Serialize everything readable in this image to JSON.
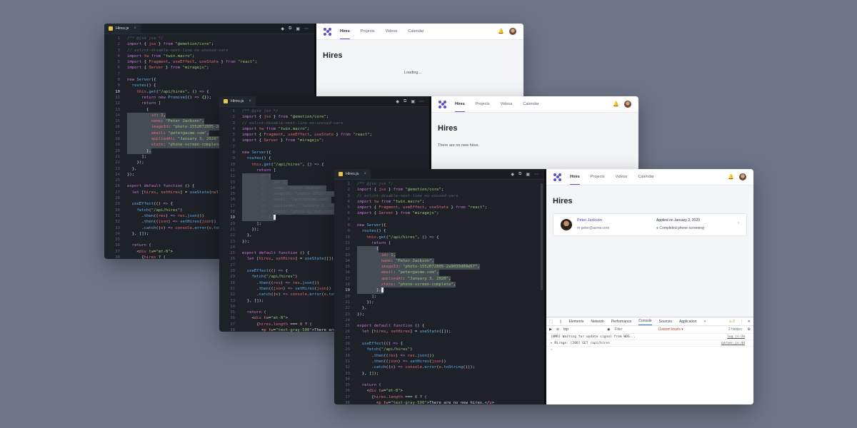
{
  "editor": {
    "filename": "Hires.js",
    "tab_close": "×",
    "icons": [
      "diamond-icon",
      "split-icon",
      "layout-icon",
      "more-icon"
    ],
    "icon_glyphs": [
      "◆",
      "⧉",
      "▣",
      "⋯"
    ]
  },
  "code_a": [
    [
      "1",
      "<span class='c'>/** @jsx jsx */</span>"
    ],
    [
      "2",
      "<span class='k'>import</span> { <span class='t'>jsx</span> } <span class='k'>from</span> <span class='s'>\"@emotion/core\"</span>;"
    ],
    [
      "3",
      "<span class='c'>// eslint-disable-next-line no-unused-vars</span>"
    ],
    [
      "4",
      "<span class='k'>import</span> <span class='t'>tw</span> <span class='k'>from</span> <span class='s'>\"twin.macro\"</span>;"
    ],
    [
      "5",
      "<span class='k'>import</span> { <span class='t'>Fragment</span>, <span class='t'>useEffect</span>, <span class='t'>useState</span> } <span class='k'>from</span> <span class='s'>\"react\"</span>;"
    ],
    [
      "6",
      "<span class='k'>import</span> { <span class='t'>Server</span> } <span class='k'>from</span> <span class='s'>\"miragejs\"</span>;"
    ],
    [
      "7",
      ""
    ],
    [
      "8",
      "<span class='k'>new</span> <span class='f'>Server</span>({"
    ],
    [
      "9",
      "  <span class='f'>routes</span>() {"
    ],
    [
      "10",
      "    <span class='t'>this</span>.<span class='f'>get</span>(<span class='s'>\"/api/hires\"</span>, () <span class='k'>=></span> {"
    ],
    [
      "11",
      "      <span class='k'>return new</span> <span class='f'>Promise</span>(() <span class='k'>=></span> {});"
    ],
    [
      "12",
      "      <span class='k'>return</span> ["
    ],
    [
      "13",
      "        {"
    ],
    [
      "14",
      "          <span class='t'>id</span>: <span class='n'>1</span>,"
    ],
    [
      "15",
      "          <span class='t'>name</span>: <span class='s'>\"Peter Jackson\"</span>,"
    ],
    [
      "16",
      "          <span class='t'>imageId</span>: <span class='s'>\"photo-1552072805-2a9039d00e57\"</span>,"
    ],
    [
      "17",
      "          <span class='t'>email</span>: <span class='s'>\"peter@acme.com\"</span>,"
    ],
    [
      "18",
      "          <span class='t'>appliedAt</span>: <span class='s'>\"January 3, 2020\"</span>,"
    ],
    [
      "19",
      "          <span class='t'>state</span>: <span class='s'>\"phone-screen-complete\"</span>,"
    ],
    [
      "20",
      "        },"
    ],
    [
      "21",
      "      ];"
    ],
    [
      "22",
      "    });"
    ],
    [
      "23",
      "  },"
    ],
    [
      "24",
      "});"
    ],
    [
      "25",
      ""
    ],
    [
      "26",
      "<span class='k'>export default function</span> () {"
    ],
    [
      "27",
      "  <span class='k'>let</span> [<span class='t'>hires</span>, <span class='t'>setHires</span>] = <span class='f'>useState</span>(<span class='n'>null</span>);"
    ],
    [
      "28",
      ""
    ],
    [
      "29",
      "  <span class='f'>useEffect</span>(() <span class='k'>=></span> {"
    ],
    [
      "30",
      "    <span class='f'>fetch</span>(<span class='s'>\"/api/hires\"</span>)"
    ],
    [
      "31",
      "      .<span class='f'>then</span>((<span class='t'>res</span>) <span class='k'>=></span> <span class='t'>res</span>.<span class='f'>json</span>())"
    ],
    [
      "32",
      "      .<span class='f'>then</span>((<span class='t'>json</span>) <span class='k'>=></span> <span class='f'>setHires</span>(<span class='t'>json</span>))"
    ],
    [
      "33",
      "      .<span class='f'>catch</span>((<span class='t'>e</span>) <span class='k'>=></span> <span class='t'>console</span>.<span class='f'>error</span>(<span class='t'>e</span>.<span class='f'>toString</span>()));"
    ],
    [
      "34",
      "  }, []);"
    ],
    [
      "35",
      ""
    ],
    [
      "36",
      "  <span class='k'>return</span> ("
    ],
    [
      "37",
      "    &lt;<span class='t'>div</span> <span class='n'>tw</span>=<span class='s'>\"mt-8\"</span>&gt;"
    ],
    [
      "38",
      "      {<span class='t'>hires</span> ? ("
    ]
  ],
  "code_b": [
    [
      "1",
      "<span class='c'>/** @jsx jsx */</span>"
    ],
    [
      "2",
      "<span class='k'>import</span> { <span class='t'>jsx</span> } <span class='k'>from</span> <span class='s'>\"@emotion/core\"</span>;"
    ],
    [
      "3",
      "<span class='c'>// eslint-disable-next-line no-unused-vars</span>"
    ],
    [
      "4",
      "<span class='k'>import</span> <span class='t'>tw</span> <span class='k'>from</span> <span class='s'>\"twin.macro\"</span>;"
    ],
    [
      "5",
      "<span class='k'>import</span> { <span class='t'>Fragment</span>, <span class='t'>useEffect</span>, <span class='t'>useState</span> } <span class='k'>from</span> <span class='s'>\"react\"</span>;"
    ],
    [
      "6",
      "<span class='k'>import</span> { <span class='t'>Server</span> } <span class='k'>from</span> <span class='s'>\"miragejs\"</span>;"
    ],
    [
      "7",
      ""
    ],
    [
      "8",
      "<span class='k'>new</span> <span class='f'>Server</span>({"
    ],
    [
      "9",
      "  <span class='f'>routes</span>() {"
    ],
    [
      "10",
      "    <span class='t'>this</span>.<span class='f'>get</span>(<span class='s'>\"/api/hires\"</span>, () <span class='k'>=></span> {"
    ],
    [
      "11",
      "      <span class='k'>return</span> ["
    ],
    [
      "12",
      "<span class='c'>        // {</span>"
    ],
    [
      "13",
      "<span class='c'>        //   id: 1,</span>"
    ],
    [
      "14",
      "<span class='c'>        //   name: \"Peter Jackson\",</span>"
    ],
    [
      "15",
      "<span class='c'>        //   imageId: \"photo-1552072805-2</span>"
    ],
    [
      "16",
      "<span class='c'>        //   email: \"peter@acme.com\",</span>"
    ],
    [
      "17",
      "<span class='c'>        //   appliedAt: \"January 3, 2020\"</span>"
    ],
    [
      "18",
      "<span class='c'>        //   state: \"phone-screen-complete</span>"
    ],
    [
      "19",
      "<span class='c'>        // },</span><span class='cursor'></span>"
    ],
    [
      "20",
      "      ];"
    ],
    [
      "21",
      "    });"
    ],
    [
      "22",
      "  },"
    ],
    [
      "23",
      "});"
    ],
    [
      "24",
      ""
    ],
    [
      "25",
      "<span class='k'>export default function</span> () {"
    ],
    [
      "26",
      "  <span class='k'>let</span> [<span class='t'>hires</span>, <span class='t'>setHires</span>] = <span class='f'>useState</span>([]);"
    ],
    [
      "27",
      ""
    ],
    [
      "28",
      "  <span class='f'>useEffect</span>(() <span class='k'>=></span> {"
    ],
    [
      "29",
      "    <span class='f'>fetch</span>(<span class='s'>\"/api/hires\"</span>)"
    ],
    [
      "30",
      "      .<span class='f'>then</span>((<span class='t'>res</span>) <span class='k'>=></span> <span class='t'>res</span>.<span class='f'>json</span>())"
    ],
    [
      "31",
      "      .<span class='f'>then</span>((<span class='t'>json</span>) <span class='k'>=></span> <span class='f'>setHires</span>(<span class='t'>json</span>))"
    ],
    [
      "32",
      "      .<span class='f'>catch</span>((<span class='t'>e</span>) <span class='k'>=></span> <span class='t'>console</span>.<span class='f'>error</span>(<span class='t'>e</span>.<span class='f'>toStrin</span>"
    ],
    [
      "33",
      "  }, []);"
    ],
    [
      "34",
      ""
    ],
    [
      "35",
      "  <span class='k'>return</span> ("
    ],
    [
      "36",
      "    &lt;<span class='t'>div</span> <span class='n'>tw</span>=<span class='s'>\"mt-8\"</span>&gt;"
    ],
    [
      "37",
      "      {<span class='t'>hires</span>.<span class='t'>length</span> === <span class='n'>0</span> ? ("
    ],
    [
      "38",
      "        &lt;<span class='t'>p</span> <span class='n'>tw</span>=<span class='s'>\"text-gray-500\"</span>&gt;There are no"
    ]
  ],
  "code_c": [
    [
      "1",
      "<span class='c'>/** @jsx jsx */</span>"
    ],
    [
      "2",
      "<span class='k'>import</span> { <span class='t'>jsx</span> } <span class='k'>from</span> <span class='s'>\"@emotion/core\"</span>;"
    ],
    [
      "3",
      "<span class='c'>// eslint-disable-next-line no-unused-vars</span>"
    ],
    [
      "4",
      "<span class='k'>import</span> <span class='t'>tw</span> <span class='k'>from</span> <span class='s'>\"twin.macro\"</span>;"
    ],
    [
      "5",
      "<span class='k'>import</span> { <span class='t'>Fragment</span>, <span class='t'>useEffect</span>, <span class='t'>useState</span> } <span class='k'>from</span> <span class='s'>\"react\"</span>;"
    ],
    [
      "6",
      "<span class='k'>import</span> { <span class='t'>Server</span> } <span class='k'>from</span> <span class='s'>\"miragejs\"</span>;"
    ],
    [
      "7",
      ""
    ],
    [
      "8",
      "<span class='k'>new</span> <span class='f'>Server</span>({"
    ],
    [
      "9",
      "  <span class='f'>routes</span>() {"
    ],
    [
      "10",
      "    <span class='t'>this</span>.<span class='f'>get</span>(<span class='s'>\"/api/hires\"</span>, () <span class='k'>=></span> {"
    ],
    [
      "11",
      "      <span class='k'>return</span> ["
    ],
    [
      "12",
      "        {"
    ],
    [
      "13",
      "          <span class='t'>id</span>: <span class='n'>1</span>,"
    ],
    [
      "14",
      "          <span class='t'>name</span>: <span class='s'>\"Peter Jackson\"</span>,"
    ],
    [
      "15",
      "          <span class='t'>imageId</span>: <span class='s'>\"photo-1552072805-2a9039d00e57\"</span>,"
    ],
    [
      "16",
      "          <span class='t'>email</span>: <span class='s'>\"peter@acme.com\"</span>,"
    ],
    [
      "17",
      "          <span class='t'>appliedAt</span>: <span class='s'>\"January 3, 2020\"</span>,"
    ],
    [
      "18",
      "          <span class='t'>state</span>: <span class='s'>\"phone-screen-complete\"</span>,"
    ],
    [
      "19",
      "        },<span class='cursor'></span>"
    ],
    [
      "20",
      "      ];"
    ],
    [
      "21",
      "    });"
    ],
    [
      "22",
      "  },"
    ],
    [
      "23",
      "});"
    ],
    [
      "24",
      ""
    ],
    [
      "25",
      "<span class='k'>export default function</span> () {"
    ],
    [
      "26",
      "  <span class='k'>let</span> [<span class='t'>hires</span>, <span class='t'>setHires</span>] = <span class='f'>useState</span>([]);"
    ],
    [
      "27",
      ""
    ],
    [
      "28",
      "  <span class='f'>useEffect</span>(() <span class='k'>=></span> {"
    ],
    [
      "29",
      "    <span class='f'>fetch</span>(<span class='s'>\"/api/hires\"</span>)"
    ],
    [
      "30",
      "      .<span class='f'>then</span>((<span class='t'>res</span>) <span class='k'>=></span> <span class='t'>res</span>.<span class='f'>json</span>())"
    ],
    [
      "31",
      "      .<span class='f'>then</span>((<span class='t'>json</span>) <span class='k'>=></span> <span class='f'>setHires</span>(<span class='t'>json</span>))"
    ],
    [
      "32",
      "      .<span class='f'>catch</span>((<span class='t'>e</span>) <span class='k'>=></span> <span class='t'>console</span>.<span class='f'>error</span>(<span class='t'>e</span>.<span class='f'>toString</span>()));"
    ],
    [
      "33",
      "  }, []);"
    ],
    [
      "34",
      ""
    ],
    [
      "35",
      "  <span class='k'>return</span> ("
    ],
    [
      "36",
      "    &lt;<span class='t'>div</span> <span class='n'>tw</span>=<span class='s'>\"mt-8\"</span>&gt;"
    ],
    [
      "37",
      "      {<span class='t'>hires</span>.<span class='t'>length</span> === <span class='n'>0</span> ? ("
    ],
    [
      "38",
      "        &lt;<span class='t'>p</span> <span class='n'>tw</span>=<span class='s'>\"text-gray-500\"</span>&gt;There are no new hires.&lt;/<span class='t'>p</span>&gt;"
    ]
  ],
  "app": {
    "nav": [
      "Hires",
      "Projects",
      "Videos",
      "Calendar"
    ],
    "title": "Hires",
    "loading": "Loading...",
    "empty": "There are no new hires.",
    "hire": {
      "name": "Peter Jackson",
      "email": "peter@acme.com",
      "applied": "Applied on January 3, 2020",
      "status": "Completed phone screening"
    }
  },
  "devtools": {
    "tabs": [
      "Elements",
      "Network",
      "Performance",
      "Console",
      "Sources",
      "Application",
      "»"
    ],
    "warnings": "⚠ 2",
    "context": "top",
    "filter_placeholder": "Filter",
    "levels": "Custom levels ▾",
    "hidden": "2 hidden",
    "logs": [
      {
        "text": "[HMR] Waiting for update signal from WDS...",
        "source": "log.js:24"
      },
      {
        "text": "▸ Mirage: [200] GET /api/hires",
        "source": "server.js:44"
      }
    ],
    "prompt": "›"
  },
  "colors": {
    "accent": "#5a4fcf",
    "background": "#6e7588",
    "editor": "#1e2127"
  }
}
